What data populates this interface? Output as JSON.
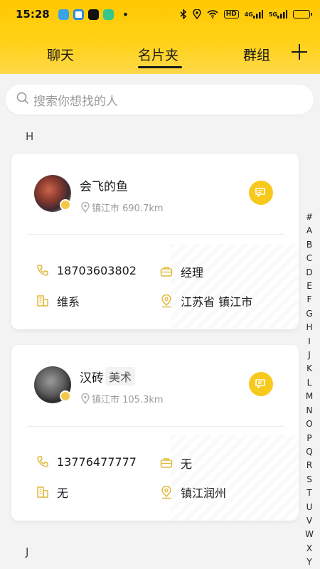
{
  "status_bar": {
    "time": "15:28",
    "dot": "•",
    "network_4g": "4G",
    "network_5g": "5G",
    "hd": "HD"
  },
  "tabs": {
    "chat": "聊天",
    "cards": "名片夹",
    "groups": "群组"
  },
  "search": {
    "placeholder": "搜索你想找的人"
  },
  "sections": [
    {
      "letter": "H",
      "cards": [
        {
          "name": "会飞的鱼",
          "tag": "",
          "location": "镇江市 690.7km",
          "phone": "18703603802",
          "title": "经理",
          "company": "维系",
          "address": "江苏省 镇江市"
        },
        {
          "name": "汉砖",
          "tag": "美术",
          "location": "镇江市 105.3km",
          "phone": "13776477777",
          "title": "无",
          "company": "无",
          "address": "镇江润州"
        }
      ]
    },
    {
      "letter": "J",
      "cards": []
    }
  ],
  "alphabet_index": [
    "#",
    "A",
    "B",
    "C",
    "D",
    "E",
    "F",
    "G",
    "H",
    "I",
    "J",
    "K",
    "L",
    "M",
    "N",
    "O",
    "P",
    "Q",
    "R",
    "S",
    "T",
    "U",
    "V",
    "W",
    "X",
    "Y"
  ],
  "colors": {
    "accent": "#ffc800",
    "chat_button": "#f7c91c",
    "icon": "#e0b93a"
  }
}
